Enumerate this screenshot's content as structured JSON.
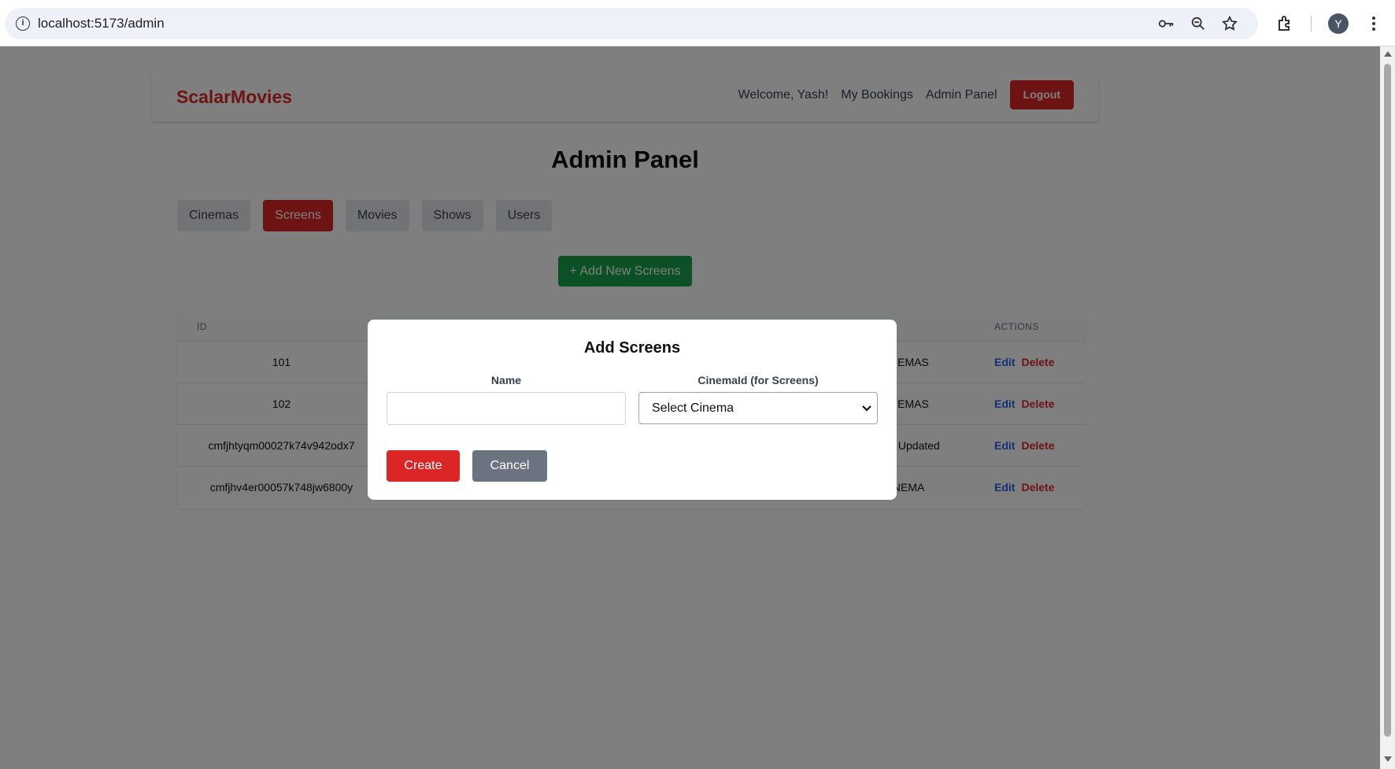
{
  "browser": {
    "url": "localhost:5173/admin",
    "profile_initial": "Y",
    "icons": [
      "info-icon",
      "key-icon",
      "zoom-icon",
      "star-icon",
      "extensions-icon",
      "menu-dots-icon"
    ]
  },
  "navbar": {
    "brand": "ScalarMovies",
    "welcome": "Welcome, Yash!",
    "my_bookings": "My Bookings",
    "admin_panel": "Admin Panel",
    "logout": "Logout"
  },
  "page": {
    "title": "Admin Panel",
    "tabs": [
      {
        "label": "Cinemas",
        "active": false
      },
      {
        "label": "Screens",
        "active": true
      },
      {
        "label": "Movies",
        "active": false
      },
      {
        "label": "Shows",
        "active": false
      },
      {
        "label": "Users",
        "active": false
      }
    ],
    "add_button": "+ Add New Screens"
  },
  "table": {
    "headers": {
      "id": "ID",
      "actions": "ACTIONS"
    },
    "rows": [
      {
        "id": "101",
        "cinema": "NEMAS",
        "edit": "Edit",
        "delete": "Delete"
      },
      {
        "id": "102",
        "cinema": "NEMAS",
        "edit": "Edit",
        "delete": "Delete"
      },
      {
        "id": "cmfjhtyqm00027k74v942odx7",
        "cinema": "y Updated",
        "edit": "Edit",
        "delete": "Delete"
      },
      {
        "id": "cmfjhv4er00057k748jw6800y",
        "cinema": "INEMA",
        "edit": "Edit",
        "delete": "Delete"
      }
    ]
  },
  "modal": {
    "title": "Add Screens",
    "name_label": "Name",
    "name_value": "",
    "cinema_label": "CinemaId (for Screens)",
    "cinema_selected": "Select Cinema",
    "create": "Create",
    "cancel": "Cancel"
  },
  "colors": {
    "primary_red": "#dc2626",
    "green": "#16a34a",
    "gray_button": "#6b7280",
    "link_blue": "#2563eb"
  }
}
